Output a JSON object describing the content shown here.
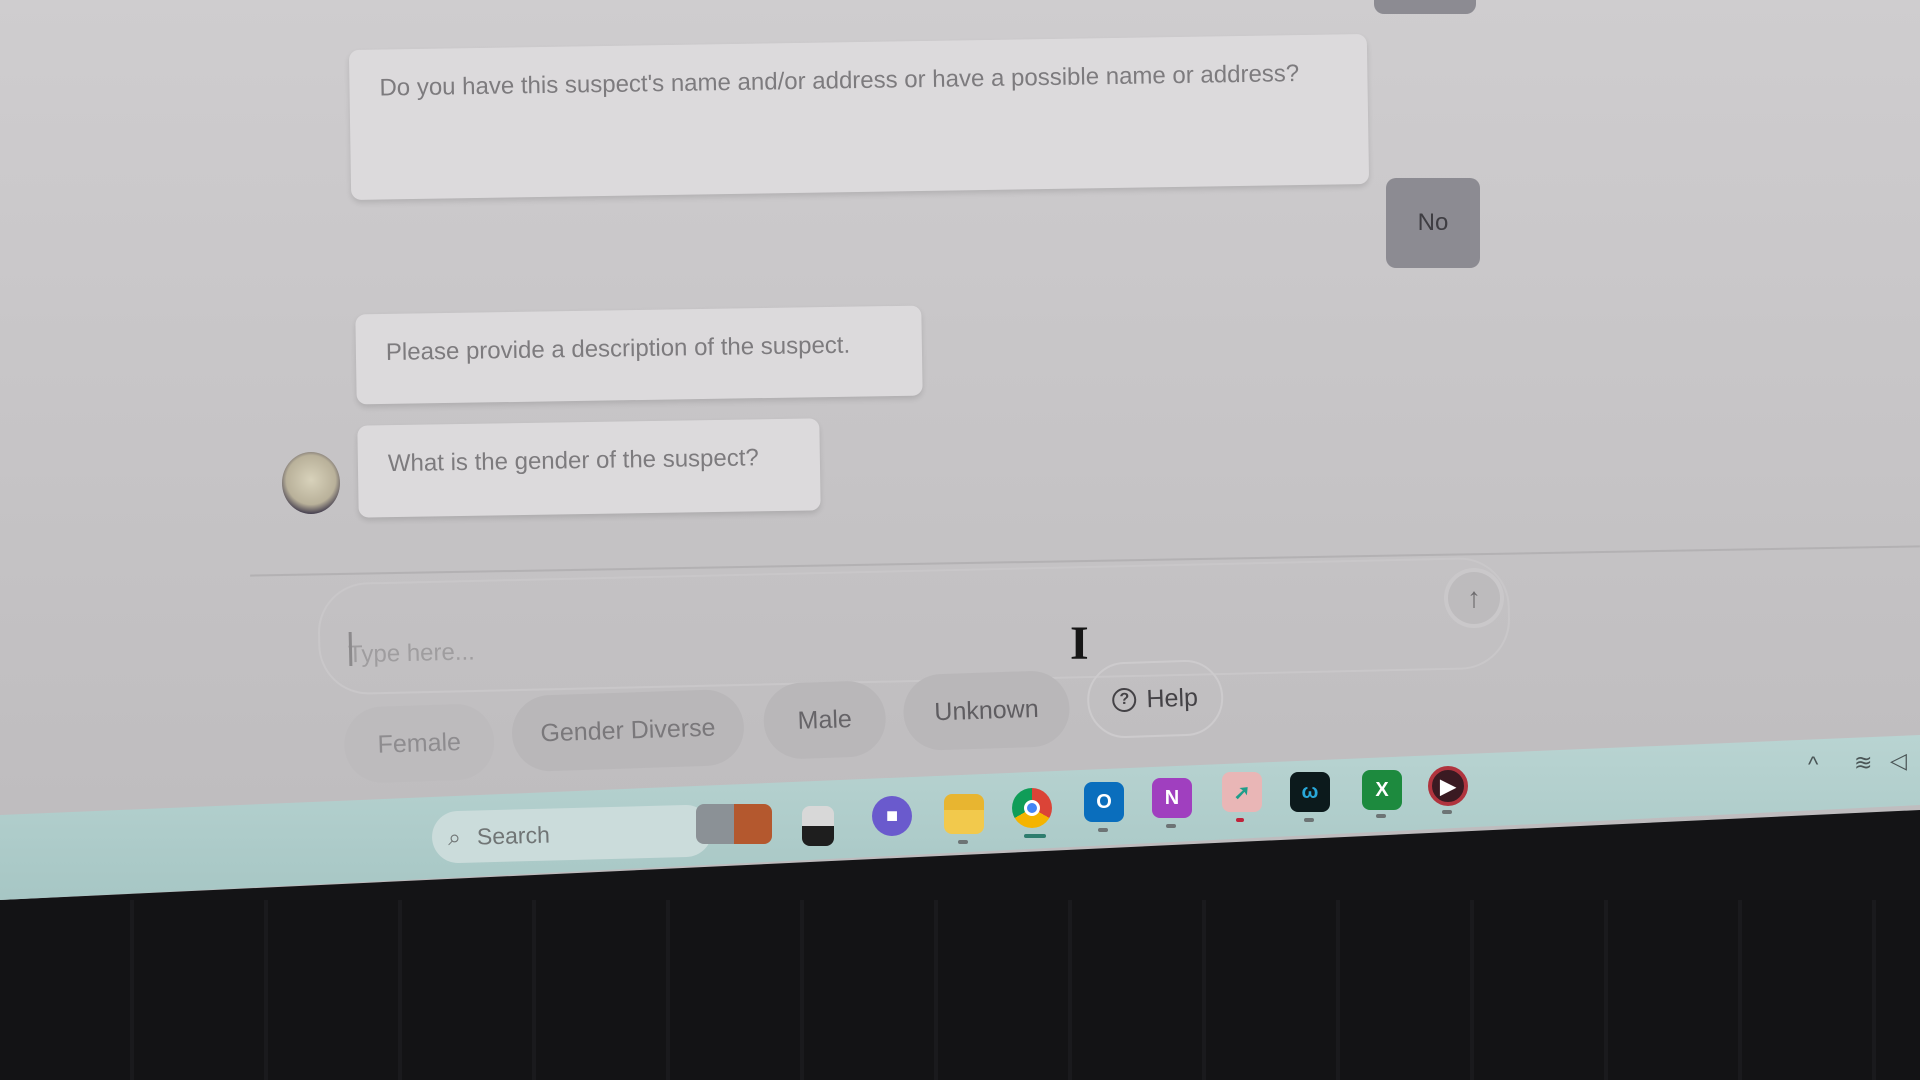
{
  "chat": {
    "messages": [
      {
        "sender": "bot",
        "text": "Do you have this suspect's name and/or address or have a possible name or address?"
      },
      {
        "sender": "user",
        "text": "No"
      },
      {
        "sender": "bot",
        "text": "Please provide a description of the suspect."
      },
      {
        "sender": "bot",
        "text": "What is the gender of the suspect?"
      }
    ],
    "bot_avatar": "police-badge-avatar"
  },
  "composer": {
    "placeholder": "Type here...",
    "value": "",
    "send_icon": "arrow-up-icon"
  },
  "quick_replies": [
    {
      "label": "Female"
    },
    {
      "label": "Gender Diverse"
    },
    {
      "label": "Male"
    },
    {
      "label": "Unknown"
    }
  ],
  "help": {
    "label": "Help",
    "icon": "question-circle-icon"
  },
  "taskbar": {
    "search_label": "Search",
    "apps": [
      {
        "name": "start",
        "icon": "windows-logo-icon"
      },
      {
        "name": "widgets",
        "icon": "briefcase-laptop-icon"
      },
      {
        "name": "task-view",
        "icon": "task-view-icon"
      },
      {
        "name": "teams-chat",
        "icon": "video-chat-icon"
      },
      {
        "name": "file-explorer",
        "icon": "folder-icon"
      },
      {
        "name": "chrome",
        "icon": "chrome-icon"
      },
      {
        "name": "outlook",
        "icon": "outlook-icon",
        "glyph": "O"
      },
      {
        "name": "onenote",
        "icon": "onenote-icon",
        "glyph": "N"
      },
      {
        "name": "app-arrow",
        "icon": "arrow-app-icon"
      },
      {
        "name": "webex",
        "icon": "webex-icon"
      },
      {
        "name": "excel",
        "icon": "excel-icon",
        "glyph": "X"
      },
      {
        "name": "media-player",
        "icon": "play-icon",
        "glyph": "▶"
      }
    ],
    "tray": {
      "chevron": "^",
      "wifi": "wifi-icon",
      "volume": "volume-icon"
    }
  },
  "cursor": "I"
}
